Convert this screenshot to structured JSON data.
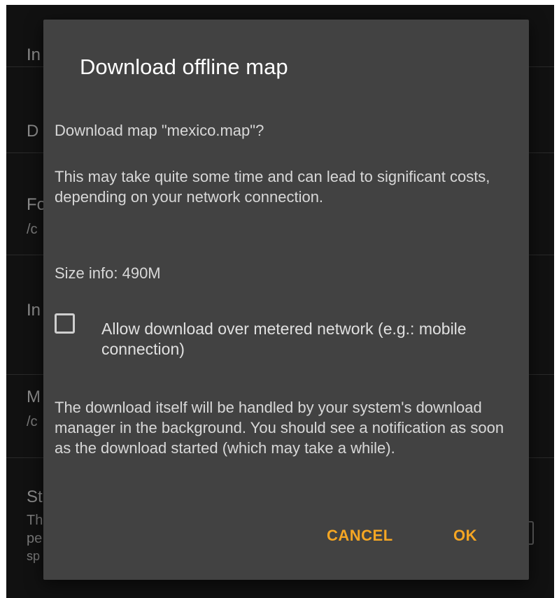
{
  "background": {
    "rows": [
      {
        "title": "In",
        "subtitle": ""
      },
      {
        "title": "D",
        "subtitle": ""
      },
      {
        "title": "Fo",
        "subtitle": "/c"
      },
      {
        "title": "In",
        "subtitle": ""
      },
      {
        "title": "M",
        "subtitle": "/c"
      },
      {
        "title": "St",
        "subtitle": "Th"
      },
      {
        "title": "pe",
        "subtitle": "sp"
      }
    ]
  },
  "dialog": {
    "title": "Download offline map",
    "question": "Download map \"mexico.map\"?",
    "warning": "This may take quite some time and can lead to significant costs, depending on your network connection.",
    "size_info": "Size info: 490M",
    "metered_checkbox": {
      "label": "Allow download over metered network (e.g.: mobile connection)",
      "checked": false
    },
    "notice": "The download itself will be handled by your system's download manager in the background. You should see a notification as soon as the download started (which may take a while).",
    "buttons": {
      "cancel": "CANCEL",
      "ok": "OK"
    },
    "accent_color": "#f5a623"
  }
}
